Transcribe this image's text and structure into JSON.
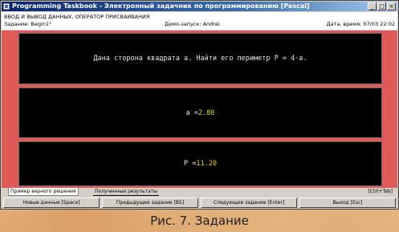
{
  "window": {
    "title": "Programming Taskbook - Электронный задачник по программированию [Pascal]",
    "controls": [
      "_",
      "□",
      "×"
    ]
  },
  "header": {
    "topic": "ВВОД И ВЫВОД ДАННЫХ, ОПЕРАТОР ПРИСВАИВАНИЯ",
    "task": "Задание: Begin1°",
    "demo": "Демо-запуск: Andrei",
    "datetime": "Дата, время: 07/03 22:02"
  },
  "panels": {
    "statement": "Дана сторона квадрата a. Найти его периметр P = 4·a.",
    "input_label": "a = ",
    "input_value": "2.80",
    "output_label": "P = ",
    "output_value": "11.20"
  },
  "tabs": {
    "sample": "Пример верного решения",
    "results": "Полученные результаты",
    "hint": "[Ctrl+Tab]"
  },
  "buttons": {
    "new_data": "Новые данные [Space]",
    "prev_task": "Предыдущее задание [BS]",
    "next_task": "Следующее задание [Enter]",
    "exit": "Выход [Esc]"
  },
  "caption": "Рис. 7. Задание",
  "colors": {
    "content_bg": "#e05a5a",
    "value_highlight": "#e8d800"
  }
}
